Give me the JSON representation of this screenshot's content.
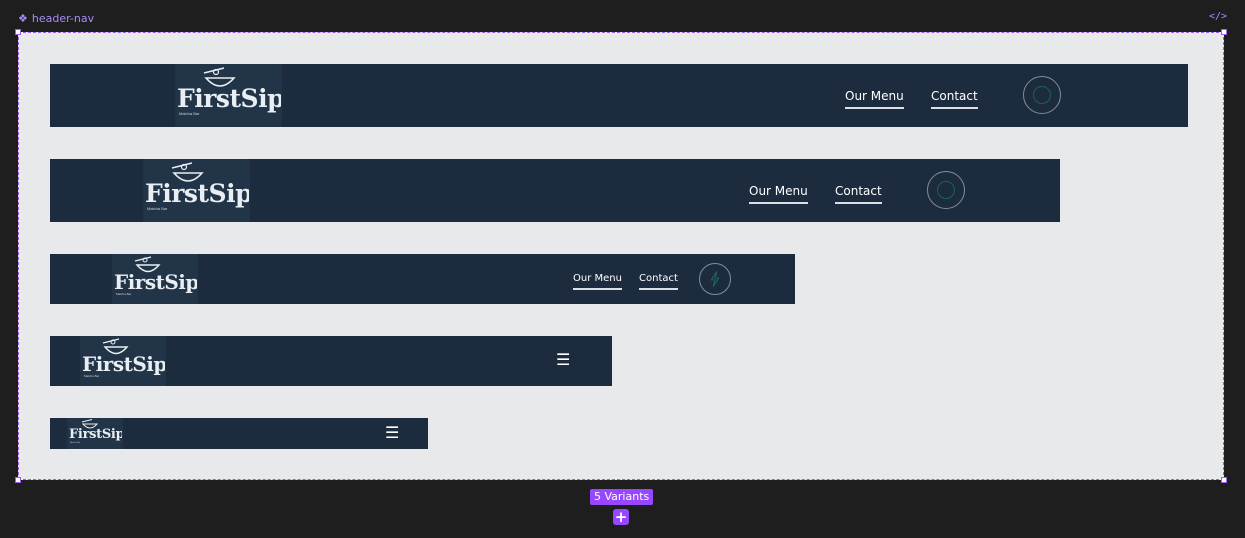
{
  "component": {
    "name": "header-nav",
    "icon": "component-diamond-icon",
    "code_icon_glyph": "</>",
    "variants_label": "5 Variants",
    "add_glyph": "+"
  },
  "brand": {
    "logo_word": "FirstSip",
    "logo_tagline": "Matcha Bar"
  },
  "nav": {
    "menu_label": "Our Menu",
    "contact_label": "Contact",
    "hamburger_glyph": "☰"
  },
  "colors": {
    "canvas": "#1e1e1e",
    "frame": "#e8e9eb",
    "bar": "#1c2c3e",
    "selection": "#9f5cf0",
    "badge": "#9747ff"
  }
}
